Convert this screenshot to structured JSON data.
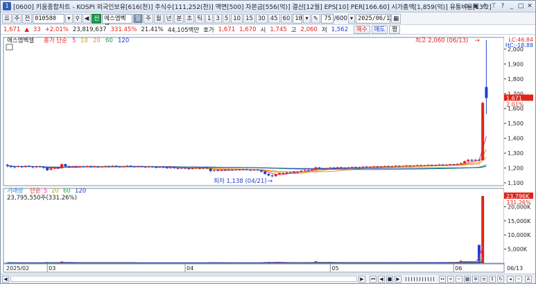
{
  "title": {
    "badge": "1",
    "text": "[0600] 키움종합차트 - KOSPI 외국인보유[616(천)] 주식수[111,252(천)] 액면[500] 자본금[556(억)] 결산[12월] EPS[10] PER[166.60] 시가총액[1,859(억)] 유통비율[13.2]"
  },
  "toolbar": {
    "mode_select": "주",
    "market_select": "전",
    "code": "010580",
    "stock_name_btn": "신",
    "stock_name": "에스엠벡셀",
    "periods": [
      "일",
      "주",
      "월",
      "년",
      "분",
      "초",
      "틱"
    ],
    "selected_period": "일",
    "intervals": [
      "1",
      "3",
      "5",
      "10",
      "15",
      "30",
      "45",
      "60"
    ],
    "interval_value": "10",
    "count": "75",
    "total": "/600",
    "date": "2025/06/13"
  },
  "quote": {
    "price": "1,671",
    "change": "33",
    "change_pct": "+2.01%",
    "volume": "23,819,637",
    "vol_ratio": "331.45%",
    "turnover": "21.41%",
    "amount": "44,105백만",
    "ask_label": "호가",
    "ask1": "1,671",
    "ask2": "1,670",
    "open_label": "시",
    "open": "1,745",
    "high_label": "고",
    "high": "2,060",
    "low_label": "저",
    "low": "1,562",
    "buy_label": "매수",
    "sell_label": "매도",
    "avg_label": "평"
  },
  "price_panel": {
    "legend_name": "에스엠벡셀",
    "legend_ma": "종가 단순",
    "ma_periods": [
      "5",
      "10",
      "20",
      "60",
      "120"
    ],
    "ma_colors": [
      "#e8338a",
      "#c8a000",
      "#f28c28",
      "#1fa055",
      "#2040c0"
    ],
    "max_label": "최고 2,060 (06/13)",
    "min_label": "최저 1,138 (04/21)",
    "lc": "LC:46.84",
    "hc": "HC:-18.88",
    "current_price": "1,671",
    "current_pct": "2.01%",
    "y_ticks": [
      "2,000",
      "1,900",
      "1,800",
      "1,700",
      "1,600",
      "1,500",
      "1,400",
      "1,300",
      "1,200",
      "1,100"
    ]
  },
  "volume_panel": {
    "legend_name": "거래량",
    "legend_ma": "단순",
    "ma_periods": [
      "5",
      "20",
      "60",
      "120"
    ],
    "ma_colors": [
      "#e8338a",
      "#c8a000",
      "#1fa055",
      "#2040c0"
    ],
    "value_text": "23,795,550주(331.26%)",
    "current_volume": "23,796K",
    "current_pct": "331.26%",
    "y_ticks": [
      "20,000K",
      "15,000K",
      "10,000K",
      "5,000K"
    ]
  },
  "x_axis": {
    "labels": [
      {
        "text": "2025/02",
        "index": 0
      },
      {
        "text": "03",
        "index": 11
      },
      {
        "text": "04",
        "index": 49
      },
      {
        "text": "05",
        "index": 89
      },
      {
        "text": "06",
        "index": 123
      }
    ],
    "right_label": "06/13"
  },
  "chart_data": {
    "type": "candlestick",
    "candles": [
      [
        1222,
        1215,
        1228,
        1205
      ],
      [
        1215,
        1208,
        1220,
        1200
      ],
      [
        1210,
        1205,
        1215,
        1198
      ],
      [
        1208,
        1212,
        1218,
        1202
      ],
      [
        1212,
        1206,
        1216,
        1200
      ],
      [
        1206,
        1214,
        1220,
        1203
      ],
      [
        1214,
        1210,
        1219,
        1205
      ],
      [
        1210,
        1205,
        1214,
        1198
      ],
      [
        1205,
        1211,
        1216,
        1200
      ],
      [
        1211,
        1207,
        1215,
        1202
      ],
      [
        1207,
        1202,
        1210,
        1195
      ],
      [
        1202,
        1185,
        1205,
        1180
      ],
      [
        1188,
        1196,
        1201,
        1184
      ],
      [
        1196,
        1202,
        1207,
        1192
      ],
      [
        1202,
        1199,
        1206,
        1194
      ],
      [
        1199,
        1226,
        1231,
        1196
      ],
      [
        1226,
        1212,
        1229,
        1207
      ],
      [
        1212,
        1205,
        1216,
        1200
      ],
      [
        1205,
        1210,
        1214,
        1201
      ],
      [
        1210,
        1207,
        1213,
        1202
      ],
      [
        1207,
        1212,
        1216,
        1204
      ],
      [
        1212,
        1209,
        1215,
        1205
      ],
      [
        1209,
        1213,
        1217,
        1205
      ],
      [
        1213,
        1208,
        1216,
        1203
      ],
      [
        1208,
        1211,
        1215,
        1204
      ],
      [
        1211,
        1206,
        1214,
        1201
      ],
      [
        1206,
        1210,
        1214,
        1203
      ],
      [
        1210,
        1213,
        1218,
        1206
      ],
      [
        1213,
        1209,
        1216,
        1204
      ],
      [
        1209,
        1214,
        1219,
        1205
      ],
      [
        1214,
        1210,
        1218,
        1206
      ],
      [
        1210,
        1207,
        1213,
        1202
      ],
      [
        1207,
        1211,
        1215,
        1203
      ],
      [
        1211,
        1215,
        1219,
        1207
      ],
      [
        1215,
        1211,
        1218,
        1207
      ],
      [
        1211,
        1208,
        1214,
        1203
      ],
      [
        1208,
        1212,
        1216,
        1204
      ],
      [
        1212,
        1209,
        1215,
        1205
      ],
      [
        1209,
        1205,
        1212,
        1200
      ],
      [
        1205,
        1210,
        1214,
        1201
      ],
      [
        1210,
        1206,
        1213,
        1202
      ],
      [
        1206,
        1203,
        1209,
        1198
      ],
      [
        1203,
        1208,
        1212,
        1199
      ],
      [
        1208,
        1204,
        1211,
        1199
      ],
      [
        1204,
        1199,
        1207,
        1194
      ],
      [
        1199,
        1204,
        1208,
        1195
      ],
      [
        1204,
        1200,
        1207,
        1195
      ],
      [
        1200,
        1196,
        1203,
        1191
      ],
      [
        1196,
        1201,
        1205,
        1192
      ],
      [
        1201,
        1197,
        1204,
        1192
      ],
      [
        1197,
        1193,
        1200,
        1188
      ],
      [
        1193,
        1198,
        1202,
        1189
      ],
      [
        1198,
        1200,
        1204,
        1194
      ],
      [
        1200,
        1195,
        1203,
        1191
      ],
      [
        1195,
        1201,
        1206,
        1192
      ],
      [
        1201,
        1197,
        1204,
        1193
      ],
      [
        1197,
        1180,
        1200,
        1172
      ],
      [
        1180,
        1185,
        1190,
        1175
      ],
      [
        1185,
        1182,
        1189,
        1177
      ],
      [
        1182,
        1188,
        1192,
        1178
      ],
      [
        1188,
        1184,
        1191,
        1179
      ],
      [
        1184,
        1189,
        1193,
        1180
      ],
      [
        1189,
        1186,
        1192,
        1181
      ],
      [
        1186,
        1191,
        1195,
        1182
      ],
      [
        1191,
        1187,
        1194,
        1183
      ],
      [
        1187,
        1192,
        1196,
        1184
      ],
      [
        1192,
        1188,
        1195,
        1184
      ],
      [
        1188,
        1184,
        1191,
        1179
      ],
      [
        1184,
        1189,
        1193,
        1180
      ],
      [
        1189,
        1185,
        1192,
        1181
      ],
      [
        1185,
        1176,
        1188,
        1170
      ],
      [
        1176,
        1160,
        1180,
        1155
      ],
      [
        1160,
        1150,
        1165,
        1145
      ],
      [
        1150,
        1145,
        1156,
        1138
      ],
      [
        1145,
        1158,
        1162,
        1142
      ],
      [
        1158,
        1165,
        1170,
        1154
      ],
      [
        1165,
        1162,
        1170,
        1158
      ],
      [
        1162,
        1170,
        1175,
        1159
      ],
      [
        1170,
        1168,
        1174,
        1163
      ],
      [
        1168,
        1176,
        1180,
        1165
      ],
      [
        1176,
        1173,
        1180,
        1169
      ],
      [
        1173,
        1181,
        1186,
        1170
      ],
      [
        1181,
        1185,
        1190,
        1177
      ],
      [
        1185,
        1183,
        1189,
        1179
      ],
      [
        1183,
        1188,
        1193,
        1180
      ],
      [
        1188,
        1204,
        1210,
        1185
      ],
      [
        1204,
        1198,
        1207,
        1194
      ],
      [
        1198,
        1194,
        1202,
        1190
      ],
      [
        1194,
        1199,
        1203,
        1190
      ],
      [
        1199,
        1203,
        1207,
        1196
      ],
      [
        1203,
        1200,
        1206,
        1196
      ],
      [
        1200,
        1205,
        1209,
        1197
      ],
      [
        1205,
        1202,
        1208,
        1198
      ],
      [
        1202,
        1198,
        1205,
        1194
      ],
      [
        1198,
        1204,
        1208,
        1195
      ],
      [
        1204,
        1207,
        1211,
        1200
      ],
      [
        1207,
        1203,
        1210,
        1199
      ],
      [
        1203,
        1206,
        1210,
        1200
      ],
      [
        1206,
        1209,
        1213,
        1202
      ],
      [
        1209,
        1205,
        1212,
        1201
      ],
      [
        1205,
        1208,
        1212,
        1202
      ],
      [
        1208,
        1211,
        1215,
        1204
      ],
      [
        1211,
        1207,
        1214,
        1203
      ],
      [
        1207,
        1210,
        1214,
        1204
      ],
      [
        1210,
        1213,
        1217,
        1206
      ],
      [
        1213,
        1209,
        1216,
        1205
      ],
      [
        1209,
        1212,
        1216,
        1206
      ],
      [
        1212,
        1215,
        1220,
        1208
      ],
      [
        1215,
        1211,
        1218,
        1207
      ],
      [
        1211,
        1214,
        1218,
        1208
      ],
      [
        1214,
        1217,
        1222,
        1210
      ],
      [
        1217,
        1213,
        1220,
        1209
      ],
      [
        1213,
        1216,
        1220,
        1210
      ],
      [
        1216,
        1219,
        1224,
        1212
      ],
      [
        1219,
        1215,
        1222,
        1211
      ],
      [
        1215,
        1218,
        1222,
        1212
      ],
      [
        1218,
        1221,
        1226,
        1214
      ],
      [
        1221,
        1217,
        1224,
        1213
      ],
      [
        1217,
        1220,
        1224,
        1214
      ],
      [
        1220,
        1223,
        1228,
        1216
      ],
      [
        1223,
        1219,
        1226,
        1215
      ],
      [
        1219,
        1222,
        1226,
        1216
      ],
      [
        1222,
        1225,
        1230,
        1218
      ],
      [
        1225,
        1221,
        1228,
        1217
      ],
      [
        1221,
        1227,
        1232,
        1218
      ],
      [
        1227,
        1232,
        1237,
        1223
      ],
      [
        1232,
        1245,
        1252,
        1228
      ],
      [
        1245,
        1255,
        1262,
        1240
      ],
      [
        1255,
        1250,
        1260,
        1245
      ],
      [
        1250,
        1255,
        1262,
        1246
      ],
      [
        1255,
        1252,
        1260,
        1248
      ],
      [
        1252,
        1638,
        1645,
        1250
      ],
      [
        1745,
        1671,
        2060,
        1562
      ]
    ],
    "volumes": [
      180,
      150,
      120,
      140,
      110,
      160,
      130,
      120,
      140,
      110,
      130,
      400,
      200,
      180,
      150,
      600,
      300,
      180,
      150,
      140,
      130,
      120,
      140,
      120,
      110,
      130,
      120,
      140,
      110,
      130,
      120,
      110,
      140,
      130,
      120,
      110,
      120,
      130,
      110,
      120,
      110,
      120,
      130,
      110,
      140,
      120,
      110,
      130,
      120,
      110,
      140,
      120,
      130,
      110,
      120,
      130,
      350,
      200,
      160,
      140,
      130,
      120,
      140,
      130,
      120,
      130,
      120,
      110,
      130,
      120,
      250,
      400,
      450,
      380,
      300,
      280,
      200,
      240,
      180,
      220,
      190,
      260,
      280,
      200,
      230,
      700,
      300,
      220,
      200,
      240,
      210,
      230,
      200,
      220,
      240,
      260,
      220,
      230,
      250,
      210,
      220,
      260,
      230,
      240,
      250,
      220,
      240,
      270,
      230,
      250,
      280,
      240,
      250,
      270,
      240,
      250,
      280,
      240,
      260,
      300,
      260,
      280,
      320,
      350,
      450,
      900,
      700,
      500,
      420,
      380,
      6500,
      23796
    ],
    "x_labels": [
      "2025/02",
      "03",
      "04",
      "05",
      "06"
    ],
    "ylim": [
      1100,
      2060
    ],
    "vol_ylim": [
      0,
      25000
    ]
  }
}
